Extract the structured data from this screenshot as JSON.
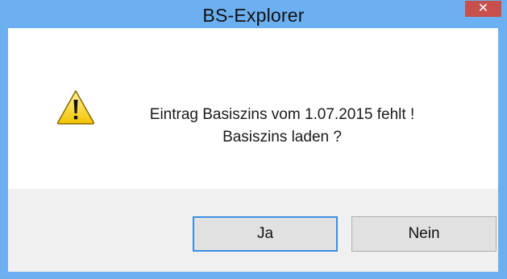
{
  "window": {
    "title": "BS-Explorer",
    "close_label": "✕"
  },
  "dialog": {
    "icon": "warning-icon",
    "message_line1": "Eintrag Basiszins vom 1.07.2015 fehlt !",
    "message_line2": "Basiszins laden ?"
  },
  "buttons": {
    "yes_label": "Ja",
    "no_label": "Nein"
  },
  "colors": {
    "titlebar": "#6cb0f2",
    "close_button": "#c7504d",
    "button_area": "#f0f0f0",
    "default_button_border": "#3c8fe0"
  }
}
